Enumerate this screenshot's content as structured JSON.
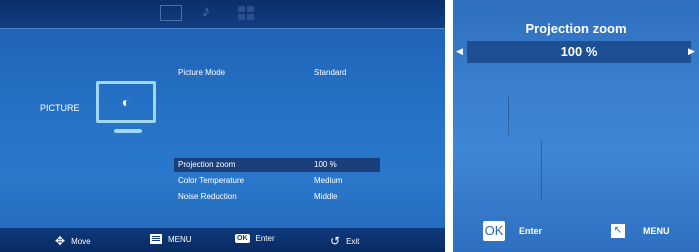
{
  "left": {
    "side_label": "PICTURE",
    "picture_mode": {
      "label": "Picture Mode",
      "value": "Standard"
    },
    "projection_zoom": {
      "label": "Projection zoom",
      "value": "100 %"
    },
    "color_temperature": {
      "label": "Color Temperature",
      "value": "Medium"
    },
    "noise_reduction": {
      "label": "Noise Reduction",
      "value": "Middle"
    },
    "hints": {
      "move": "Move",
      "menu": "MENU",
      "ok": "OK",
      "enter": "Enter",
      "exit": "Exit"
    }
  },
  "right": {
    "title": "Projection zoom",
    "value": "100 %",
    "ok": "OK",
    "enter": "Enter",
    "menu": "MENU"
  },
  "icons": [
    "tv-icon",
    "music-icon",
    "app-icon",
    "monitor-icon",
    "brightness-icon",
    "move-icon",
    "menu-icon",
    "ok-icon",
    "exit-icon",
    "left-arrow-icon",
    "right-arrow-icon",
    "back-icon"
  ],
  "colors": {
    "panel_blue": "#2470c4",
    "selected_row": "#1a3f7a",
    "top_bar": "#0b2f6a"
  }
}
